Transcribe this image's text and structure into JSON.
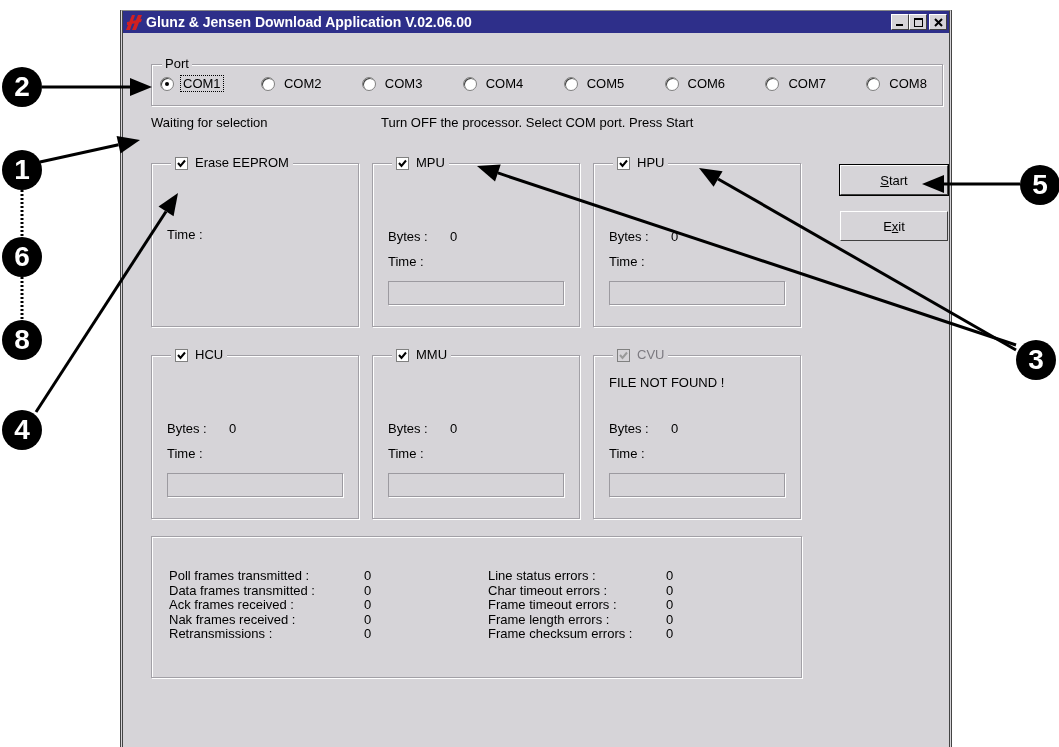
{
  "window": {
    "title": "Glunz & Jensen Download Application V.02.06.00"
  },
  "port": {
    "label": "Port",
    "options": [
      {
        "label": "COM1",
        "selected": true
      },
      {
        "label": "COM2",
        "selected": false
      },
      {
        "label": "COM3",
        "selected": false
      },
      {
        "label": "COM4",
        "selected": false
      },
      {
        "label": "COM5",
        "selected": false
      },
      {
        "label": "COM6",
        "selected": false
      },
      {
        "label": "COM7",
        "selected": false
      },
      {
        "label": "COM8",
        "selected": false
      }
    ]
  },
  "status": {
    "state": "Waiting for selection",
    "instruction": "Turn OFF the processor. Select COM port. Press Start"
  },
  "modules": [
    {
      "kind": "erase",
      "label": "Erase EEPROM",
      "checked": true,
      "disabled": false,
      "time_label": "Time :"
    },
    {
      "kind": "unit",
      "label": "MPU",
      "checked": true,
      "disabled": false,
      "bytes_label": "Bytes :",
      "bytes": "0",
      "time_label": "Time :",
      "level": 0
    },
    {
      "kind": "unit",
      "label": "HPU",
      "checked": true,
      "disabled": false,
      "bytes_label": "Bytes :",
      "bytes": "0",
      "time_label": "Time :",
      "level": 0
    },
    {
      "kind": "unit",
      "label": "HCU",
      "checked": true,
      "disabled": false,
      "bytes_label": "Bytes :",
      "bytes": "0",
      "time_label": "Time :",
      "level": 0
    },
    {
      "kind": "unit",
      "label": "MMU",
      "checked": true,
      "disabled": false,
      "bytes_label": "Bytes :",
      "bytes": "0",
      "time_label": "Time :",
      "level": 0
    },
    {
      "kind": "unit",
      "label": "CVU",
      "checked": true,
      "disabled": true,
      "message": "FILE NOT FOUND !",
      "bytes_label": "Bytes :",
      "bytes": "0",
      "time_label": "Time :",
      "level": 0
    }
  ],
  "buttons": [
    {
      "mnemonic": "S",
      "after": "tart",
      "default": true
    },
    {
      "before": "E",
      "mnemonic": "x",
      "after": "it",
      "default": false
    }
  ],
  "statistics": {
    "left": [
      {
        "label": "Poll frames transmitted :",
        "value": "0"
      },
      {
        "label": "Data frames transmitted :",
        "value": "0"
      },
      {
        "label": "Ack frames received :",
        "value": "0"
      },
      {
        "label": "Nak frames received :",
        "value": "0"
      },
      {
        "label": "Retransmissions :",
        "value": "0"
      }
    ],
    "right": [
      {
        "label": "Line status errors :",
        "value": "0"
      },
      {
        "label": "Char timeout errors :",
        "value": "0"
      },
      {
        "label": "Frame timeout errors :",
        "value": "0"
      },
      {
        "label": "Frame length errors :",
        "value": "0"
      },
      {
        "label": "Frame checksum errors :",
        "value": "0"
      }
    ]
  },
  "callouts": [
    {
      "number": "2"
    },
    {
      "number": "1"
    },
    {
      "number": "6"
    },
    {
      "number": "8"
    },
    {
      "number": "4"
    },
    {
      "number": "5"
    },
    {
      "number": "3"
    }
  ]
}
